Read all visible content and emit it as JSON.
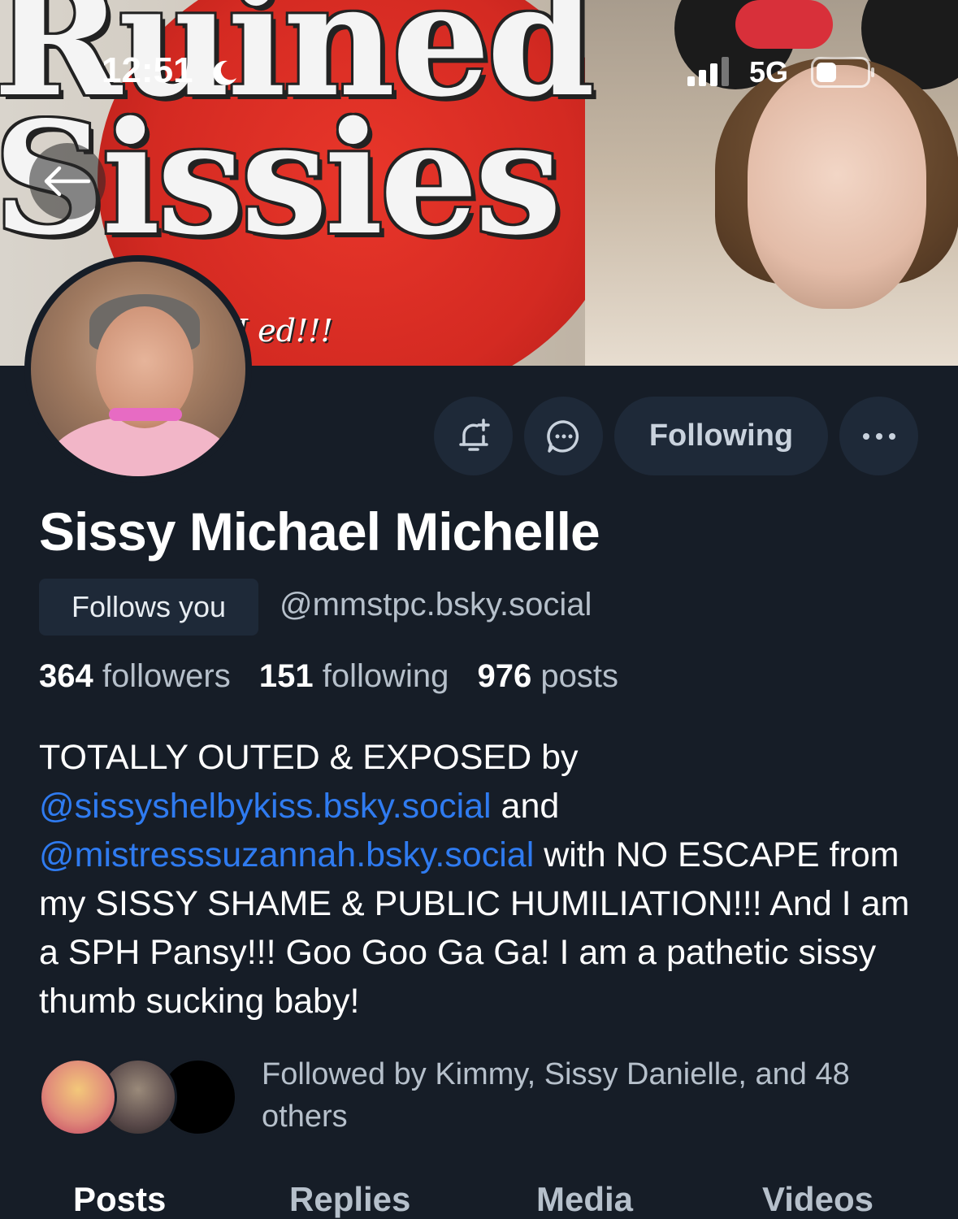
{
  "status_bar": {
    "time": "12:51",
    "network": "5G"
  },
  "banner": {
    "title_line1": "Ruined",
    "title_line2": "Sissies",
    "subtitle": "I ed!!!"
  },
  "profile": {
    "display_name": "Sissy Michael Michelle",
    "follows_you_label": "Follows you",
    "handle": "@mmstpc.bsky.social",
    "following_button_label": "Following",
    "stats": {
      "followers_count": "364",
      "followers_label": "followers",
      "following_count": "151",
      "following_label": "following",
      "posts_count": "976",
      "posts_label": "posts"
    },
    "bio": {
      "part1": "TOTALLY OUTED & EXPOSED by ",
      "mention1": "@sissyshelbykiss.bsky.social",
      "part2": " and ",
      "mention2": "@mistresssuzannah.bsky.social",
      "part3": " with NO ESCAPE from my SISSY SHAME & PUBLIC HUMILIATION!!! And I am a SPH Pansy!!! Goo Goo Ga Ga! I am a pathetic sissy thumb sucking baby!"
    },
    "followed_by_text": "Followed by Kimmy, Sissy Danielle, and 48 others"
  },
  "tabs": [
    {
      "label": "Posts"
    },
    {
      "label": "Replies"
    },
    {
      "label": "Media"
    },
    {
      "label": "Videos"
    }
  ],
  "colors": {
    "background": "#161d27",
    "button_bg": "#1e2938",
    "mention": "#2f7bf0",
    "muted_text": "#b6c0cb"
  },
  "icons": [
    "back-arrow-icon",
    "bell-plus-icon",
    "chat-bubble-icon",
    "more-dots-icon",
    "moon-icon",
    "signal-icon",
    "battery-icon"
  ]
}
